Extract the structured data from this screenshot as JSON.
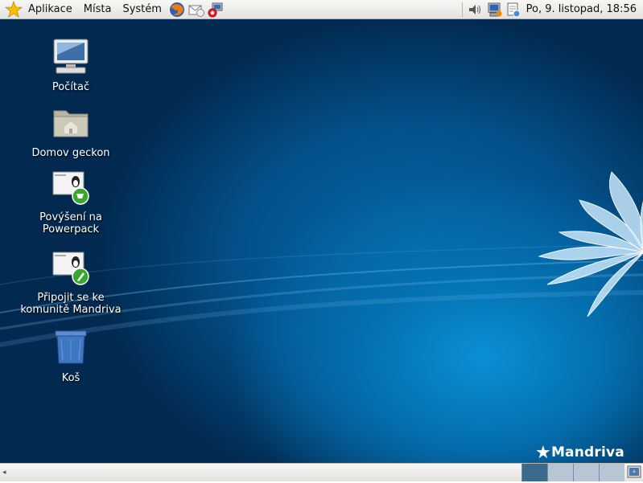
{
  "top_panel": {
    "menus": [
      "Aplikace",
      "Místa",
      "Systém"
    ],
    "clock": "Po,  9. listopad, 18:56",
    "launchers": [
      "firefox-icon",
      "mail-icon",
      "network-icon"
    ],
    "tray": [
      "volume-icon",
      "network-status-icon",
      "updates-icon"
    ]
  },
  "desktop": {
    "icons": [
      {
        "label": "Počítač"
      },
      {
        "label": "Domov geckon"
      },
      {
        "label": "Povýšení na\nPowerpack"
      },
      {
        "label": "Připojit se ke\nkomunitě Mandriva"
      },
      {
        "label": "Koš"
      }
    ],
    "brand": "Mandriva"
  },
  "bottom_panel": {
    "workspaces": 4,
    "active_workspace": 1
  },
  "colors": {
    "accent": "#0a8fd6",
    "panel": "#e9e8e5",
    "active_workspace": "#3a6a8c"
  }
}
